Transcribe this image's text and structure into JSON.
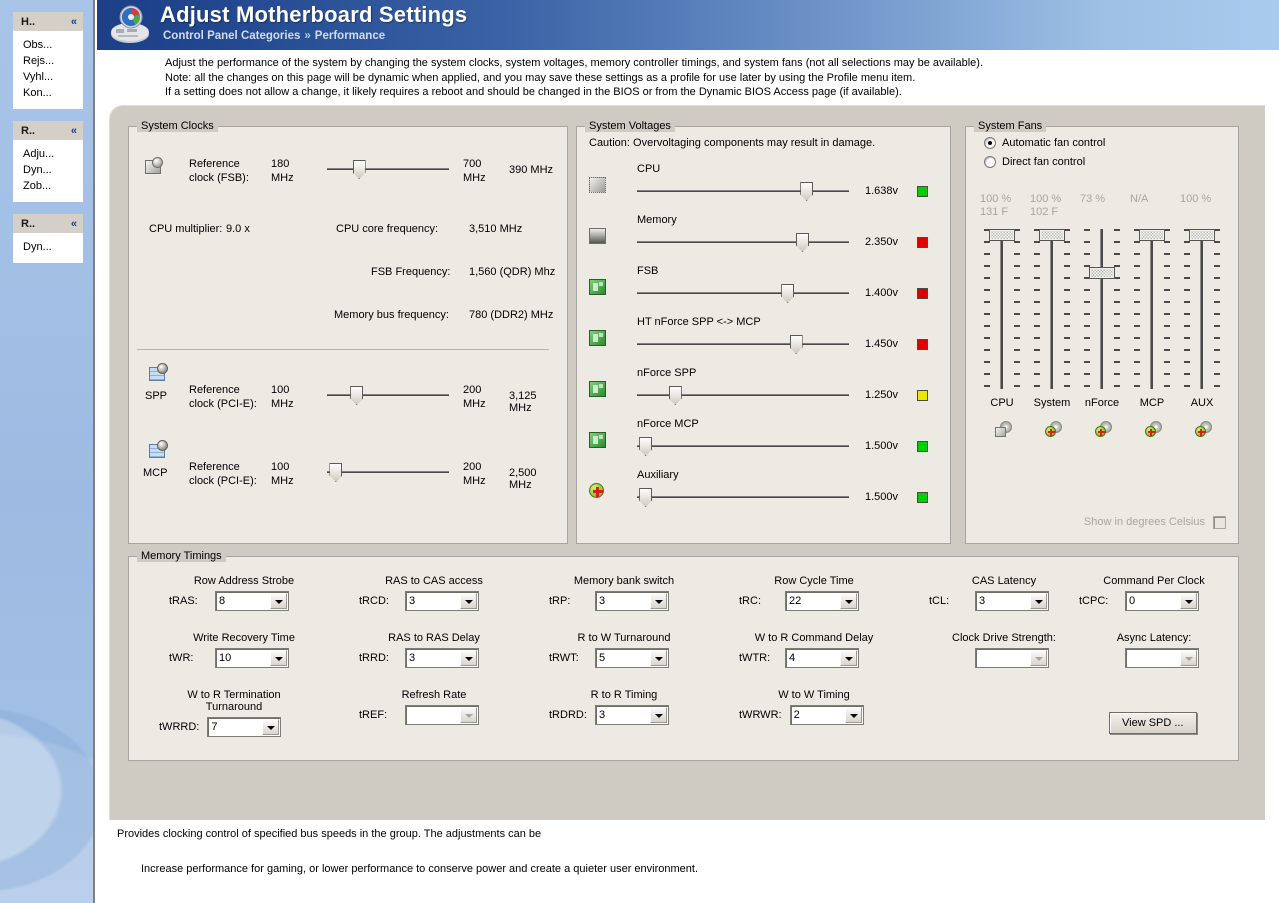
{
  "sidebar": {
    "groups": [
      {
        "title": "H..",
        "items": [
          "Obs...",
          "Rejs...",
          "Vyhl...",
          "Kon..."
        ]
      },
      {
        "title": "R..",
        "items": [
          "Adju...",
          "Dyn...",
          "Zob..."
        ]
      },
      {
        "title": "R..",
        "items": [
          "Dyn..."
        ]
      }
    ],
    "collapse_icon": "«"
  },
  "header": {
    "title": "Adjust Motherboard Settings",
    "breadcrumb_root": "Control Panel Categories",
    "breadcrumb_sep": "»",
    "breadcrumb_leaf": "Performance",
    "icon": "motherboard-icon",
    "gradient_start": "#1c3f86",
    "gradient_end": "#a8cbee"
  },
  "description": {
    "line1": "Adjust the performance of the system by changing the system clocks, system voltages,  memory controller timings, and system fans (not all selections may be available).",
    "line2": "Note: all the changes on this page will be dynamic when applied, and you may save these settings as a profile for use later by using the Profile menu item.",
    "line3": "If a setting does not allow a change, it likely requires a reboot and should be changed in the BIOS or from the Dynamic BIOS Access page (if available)."
  },
  "system_clocks": {
    "legend": "System Clocks",
    "fsb": {
      "icon": "cpu-clock-icon",
      "label_line1": "Reference",
      "label_line2": "clock (FSB):",
      "min_value": "180",
      "min_unit": "MHz",
      "max_value": "700",
      "max_unit": "MHz",
      "current": "390 MHz",
      "thumb_pct": 21
    },
    "cpu_multiplier_label": "CPU multiplier:",
    "cpu_multiplier_value": "9.0 x",
    "cpu_core_freq_label": "CPU core frequency:",
    "cpu_core_freq_value": "3,510 MHz",
    "fsb_freq_label": "FSB Frequency:",
    "fsb_freq_value": "1,560 (QDR) Mhz",
    "mem_bus_label": "Memory bus frequency:",
    "mem_bus_value": "780 (DDR2) MHz",
    "spp": {
      "icon": "spp-chip-icon",
      "tag": "SPP",
      "label_line1": "Reference",
      "label_line2": "clock (PCI-E):",
      "min_value": "100",
      "min_unit": "MHz",
      "max_value": "200",
      "max_unit": "MHz",
      "current": "3,125 MHz",
      "thumb_pct": 19
    },
    "mcp": {
      "icon": "mcp-chip-icon",
      "tag": "MCP",
      "label_line1": "Reference",
      "label_line2": "clock (PCI-E):",
      "min_value": "100",
      "min_unit": "MHz",
      "max_value": "200",
      "max_unit": "MHz",
      "current": "2,500 MHz",
      "thumb_pct": 2
    }
  },
  "system_voltages": {
    "legend": "System Voltages",
    "caution": "Caution: Overvoltaging components may result in damage.",
    "rails": [
      {
        "icon": "cpu-icon",
        "name": "CPU",
        "value": "1.638v",
        "led": "#00d000",
        "thumb_pct": 77
      },
      {
        "icon": "memory-icon",
        "name": "Memory",
        "value": "2.350v",
        "led": "#e00000",
        "thumb_pct": 75
      },
      {
        "icon": "board-icon",
        "name": "FSB",
        "value": "1.400v",
        "led": "#e00000",
        "thumb_pct": 68
      },
      {
        "icon": "board-icon",
        "name": "HT nForce SPP <-> MCP",
        "value": "1.450v",
        "led": "#e00000",
        "thumb_pct": 72
      },
      {
        "icon": "board-icon",
        "name": "nForce SPP",
        "value": "1.250v",
        "led": "#e8e800",
        "thumb_pct": 15
      },
      {
        "icon": "board-icon",
        "name": "nForce MCP",
        "value": "1.500v",
        "led": "#00d000",
        "thumb_pct": 1
      },
      {
        "icon": "aux-plus-icon",
        "name": "Auxiliary",
        "value": "1.500v",
        "led": "#00d000",
        "thumb_pct": 1
      }
    ]
  },
  "system_fans": {
    "legend": "System Fans",
    "auto_label": "Automatic fan control",
    "direct_label": "Direct fan control",
    "mode": "automatic",
    "fans": [
      {
        "name": "CPU",
        "percent": "100 %",
        "temp": "131 F",
        "thumb_pct": 100,
        "icon": "fan-disabled-icon"
      },
      {
        "name": "System",
        "percent": "100 %",
        "temp": "102 F",
        "thumb_pct": 100,
        "icon": "fan-add-icon"
      },
      {
        "name": "nForce",
        "percent": "73 %",
        "temp": "",
        "thumb_pct": 73,
        "icon": "fan-add-icon"
      },
      {
        "name": "MCP",
        "percent": "N/A",
        "temp": "",
        "thumb_pct": 100,
        "icon": "fan-add-icon"
      },
      {
        "name": "AUX",
        "percent": "100 %",
        "temp": "",
        "thumb_pct": 100,
        "icon": "fan-add-icon"
      }
    ],
    "celsius_label": "Show in degrees Celsius",
    "celsius_checked": false
  },
  "memory_timings": {
    "legend": "Memory Timings",
    "fields": [
      {
        "caption": "Row Address Strobe",
        "label": "tRAS:",
        "value": "8",
        "disabled": false
      },
      {
        "caption": "RAS to CAS access",
        "label": "tRCD:",
        "value": "3",
        "disabled": false
      },
      {
        "caption": "Memory bank switch",
        "label": "tRP:",
        "value": "3",
        "disabled": false
      },
      {
        "caption": "Row Cycle Time",
        "label": "tRC:",
        "value": "22",
        "disabled": false
      },
      {
        "caption": "CAS Latency",
        "label": "tCL:",
        "value": "3",
        "disabled": false
      },
      {
        "caption": "Command Per Clock",
        "label": "tCPC:",
        "value": "0",
        "disabled": false
      },
      {
        "caption": "Write Recovery Time",
        "label": "tWR:",
        "value": "10",
        "disabled": false
      },
      {
        "caption": "RAS to RAS Delay",
        "label": "tRRD:",
        "value": "3",
        "disabled": false
      },
      {
        "caption": "R to W Turnaround",
        "label": "tRWT:",
        "value": "5",
        "disabled": false
      },
      {
        "caption": "W to R Command Delay",
        "label": "tWTR:",
        "value": "4",
        "disabled": false
      },
      {
        "caption": "Clock Drive Strength:",
        "label": "",
        "value": "",
        "disabled": true
      },
      {
        "caption": "Async Latency:",
        "label": "",
        "value": "",
        "disabled": true
      },
      {
        "caption": "W to R Termination Turnaround",
        "label": "tWRRD:",
        "value": "7",
        "disabled": false
      },
      {
        "caption": "Refresh Rate",
        "label": "tREF:",
        "value": "",
        "disabled": true
      },
      {
        "caption": "R to R Timing",
        "label": "tRDRD:",
        "value": "3",
        "disabled": false
      },
      {
        "caption": "W to W Timing",
        "label": "tWRWR:",
        "value": "2",
        "disabled": false
      }
    ],
    "view_spd_label": "View SPD ..."
  },
  "footer": {
    "line1": "Provides clocking control of specified bus speeds in the group. The adjustments can be",
    "line2": "Increase performance for gaming, or lower performance to conserve power and create a quieter user environment."
  }
}
